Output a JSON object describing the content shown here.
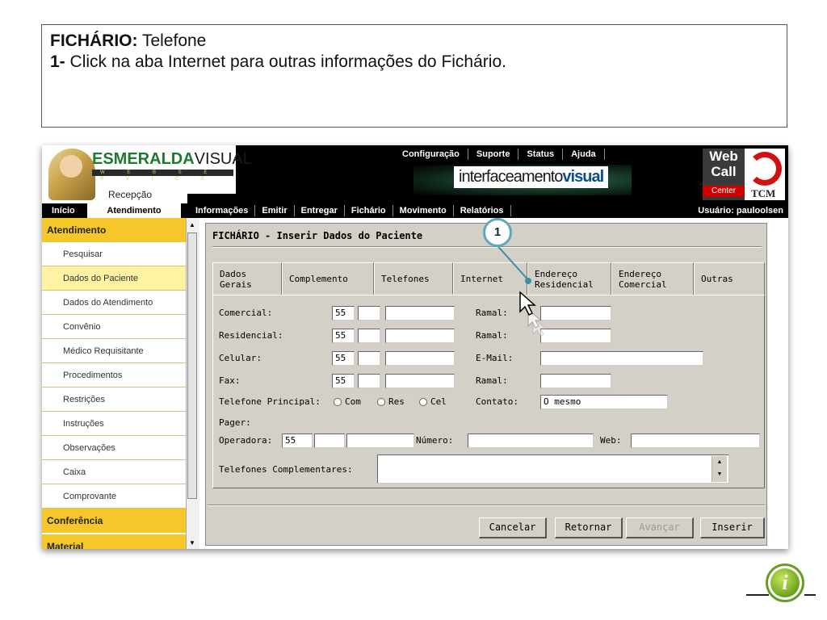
{
  "instruction": {
    "title_bold": "FICHÁRIO:",
    "title_rest": " Telefone",
    "step_bold": "1-",
    "step_rest": " Click na aba Internet para outras informações do Fichário."
  },
  "header": {
    "brand_left": "ESMERALDA",
    "brand_right": "VISUAL",
    "brand_sub": "W E B   S E R V I C E",
    "location": "Recepção",
    "top_menu": [
      "Configuração",
      "Suporte",
      "Status",
      "Ajuda"
    ],
    "center_logo_a": "interfaceamento",
    "center_logo_b": "visual",
    "webcall_1": "Web",
    "webcall_2": "Call",
    "webcall_3": "Center",
    "tcm": "TCM"
  },
  "navbar": {
    "inicio": "Início",
    "atendimento": "Atendimento",
    "menu": [
      "Informações",
      "Emitir",
      "Entregar",
      "Fichário",
      "Movimento",
      "Relatórios"
    ],
    "user": "Usuário: pauloolsen"
  },
  "sidebar": {
    "section1": "Atendimento",
    "items": [
      "Pesquisar",
      "Dados do Paciente",
      "Dados do Atendimento",
      "Convênio",
      "Médico Requisitante",
      "Procedimentos",
      "Restrições",
      "Instruções",
      "Observações",
      "Caixa",
      "Comprovante"
    ],
    "active_index": 1,
    "section2": "Conferência",
    "section3": "Material"
  },
  "main": {
    "title": "FICHÁRIO - Inserir Dados do Paciente",
    "tabs": [
      {
        "line1": "Dados",
        "line2": "Gerais"
      },
      {
        "line1": "Complemento",
        "line2": ""
      },
      {
        "line1": "Telefones",
        "line2": ""
      },
      {
        "line1": "Internet",
        "line2": ""
      },
      {
        "line1": "Endereço",
        "line2": "Residencial"
      },
      {
        "line1": "Endereço",
        "line2": "Comercial"
      },
      {
        "line1": "Outras",
        "line2": ""
      }
    ],
    "labels": {
      "comercial": "Comercial:",
      "residencial": "Residencial:",
      "celular": "Celular:",
      "fax": "Fax:",
      "telefone_principal": "Telefone Principal:",
      "ramal": "Ramal:",
      "email": "E-Mail:",
      "contato": "Contato:",
      "pager": "Pager:",
      "operadora": "Operadora:",
      "numero": "Número:",
      "web": "Web:",
      "telefones_complementares": "Telefones Complementares:"
    },
    "radio_options": [
      "Com",
      "Res",
      "Cel"
    ],
    "ddi_default": "55",
    "operadora_value": "55",
    "contato_value": "O mesmo",
    "buttons": {
      "cancelar": "Cancelar",
      "retornar": "Retornar",
      "avancar": "Avançar",
      "inserir": "Inserir"
    }
  },
  "callout": {
    "number": "1"
  },
  "info_icon": {
    "glyph": "i"
  },
  "icons": [
    "info-icon",
    "mouse-cursor-icon",
    "scroll-up-arrow-icon",
    "scroll-down-arrow-icon"
  ]
}
